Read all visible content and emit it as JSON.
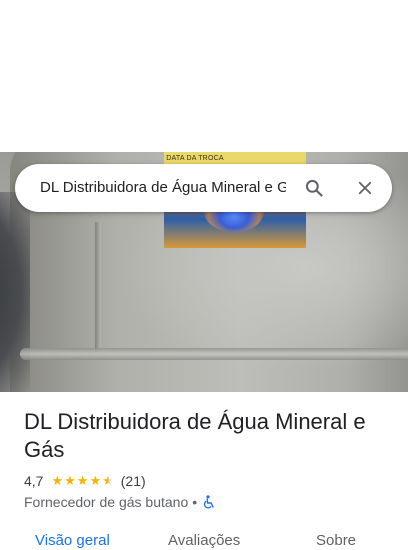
{
  "search": {
    "query": "DL Distribuidora de Água Mineral e G"
  },
  "photo": {
    "label_text": "DATA DA TROCA"
  },
  "place": {
    "title": "DL Distribuidora de Água Mineral e Gás",
    "rating": "4,7",
    "rating_value": 4.7,
    "review_count": "(21)",
    "category": "Fornecedor de gás butano",
    "separator": "•",
    "accessibility_icon": "wheelchair-icon"
  },
  "tabs": [
    {
      "label": "Visão geral",
      "active": true
    },
    {
      "label": "Avaliações",
      "active": false
    },
    {
      "label": "Sobre",
      "active": false
    }
  ],
  "colors": {
    "accent": "#1a73e8",
    "star": "#f4b400",
    "text": "#202124",
    "muted": "#5f6368"
  }
}
